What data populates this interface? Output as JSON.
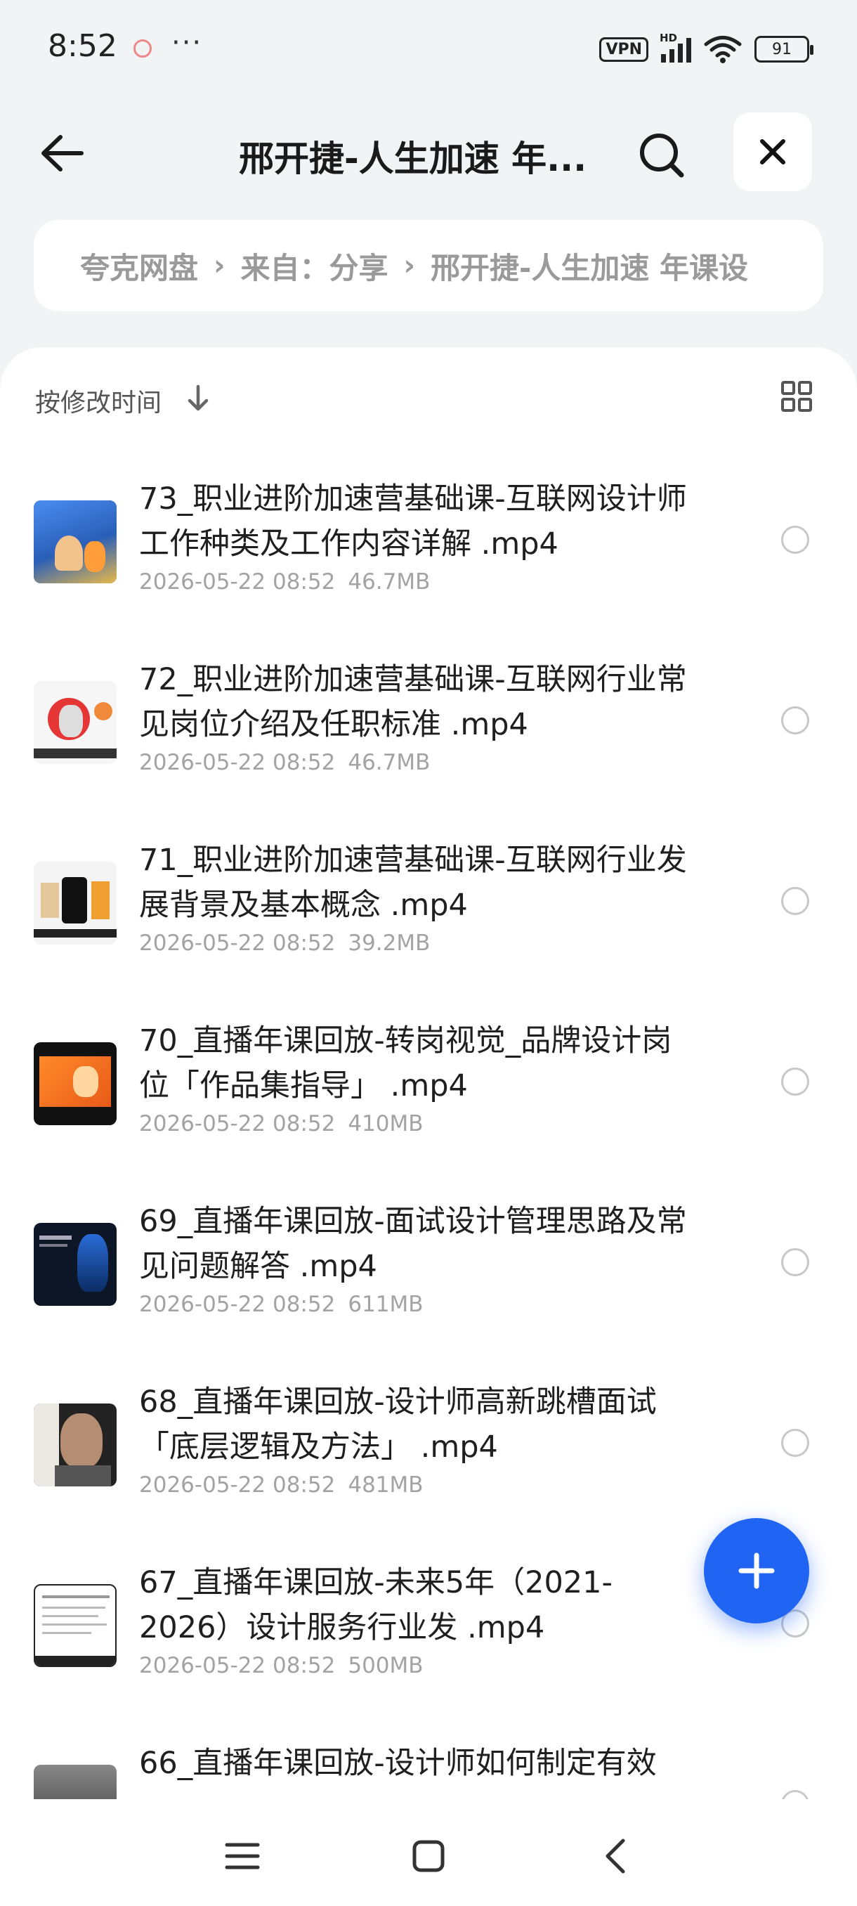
{
  "status_bar": {
    "time": "8:52",
    "more": "···",
    "vpn": "VPN",
    "network": "HD",
    "battery": "91"
  },
  "header": {
    "title": "邢开捷-人生加速 年...",
    "back_icon": "arrow-left-icon",
    "search_icon": "search-icon",
    "close_icon": "close-icon"
  },
  "breadcrumb": {
    "items": [
      "夸克网盘",
      "来自：分享",
      "邢开捷-人生加速 年课设"
    ],
    "separator": "›"
  },
  "sort": {
    "label": "按修改时间",
    "direction_icon": "arrow-down-icon",
    "view_icon": "grid-view-icon"
  },
  "files": [
    {
      "name": "73_职业进阶加速营基础课-互联网设计师工作种类及工作内容详解 .mp4",
      "date": "2026-05-22 08:52",
      "size": "46.7MB",
      "thumb_color": "#3a7bd5"
    },
    {
      "name": "72_职业进阶加速营基础课-互联网行业常见岗位介绍及任职标准 .mp4",
      "date": "2026-05-22 08:52",
      "size": "46.7MB",
      "thumb_color": "#f4f4f4"
    },
    {
      "name": "71_职业进阶加速营基础课-互联网行业发展背景及基本概念 .mp4",
      "date": "2026-05-22 08:52",
      "size": "39.2MB",
      "thumb_color": "#f4f4f4"
    },
    {
      "name": "70_直播年课回放-转岗视觉_品牌设计岗位「作品集指导」 .mp4",
      "date": "2026-05-22 08:52",
      "size": "410MB",
      "thumb_color": "#ff7a1a"
    },
    {
      "name": "69_直播年课回放-面试设计管理思路及常见问题解答 .mp4",
      "date": "2026-05-22 08:52",
      "size": "611MB",
      "thumb_color": "#0d1a2e"
    },
    {
      "name": "68_直播年课回放-设计师高新跳槽面试「底层逻辑及方法」 .mp4",
      "date": "2026-05-22 08:52",
      "size": "481MB",
      "thumb_color": "#6b5a50"
    },
    {
      "name": "67_直播年课回放-未来5年（2021-2026）设计服务行业发 .mp4",
      "date": "2026-05-22 08:52",
      "size": "500MB",
      "thumb_color": "#ffffff"
    },
    {
      "name": "66_直播年课回放-设计师如何制定有效",
      "date": "",
      "size": "",
      "thumb_color": "#555555"
    }
  ],
  "fab": {
    "icon": "plus-icon",
    "color": "#1f64f2"
  },
  "nav": {
    "menu_icon": "menu-icon",
    "home_icon": "square-icon",
    "back_icon": "chevron-left-icon"
  }
}
